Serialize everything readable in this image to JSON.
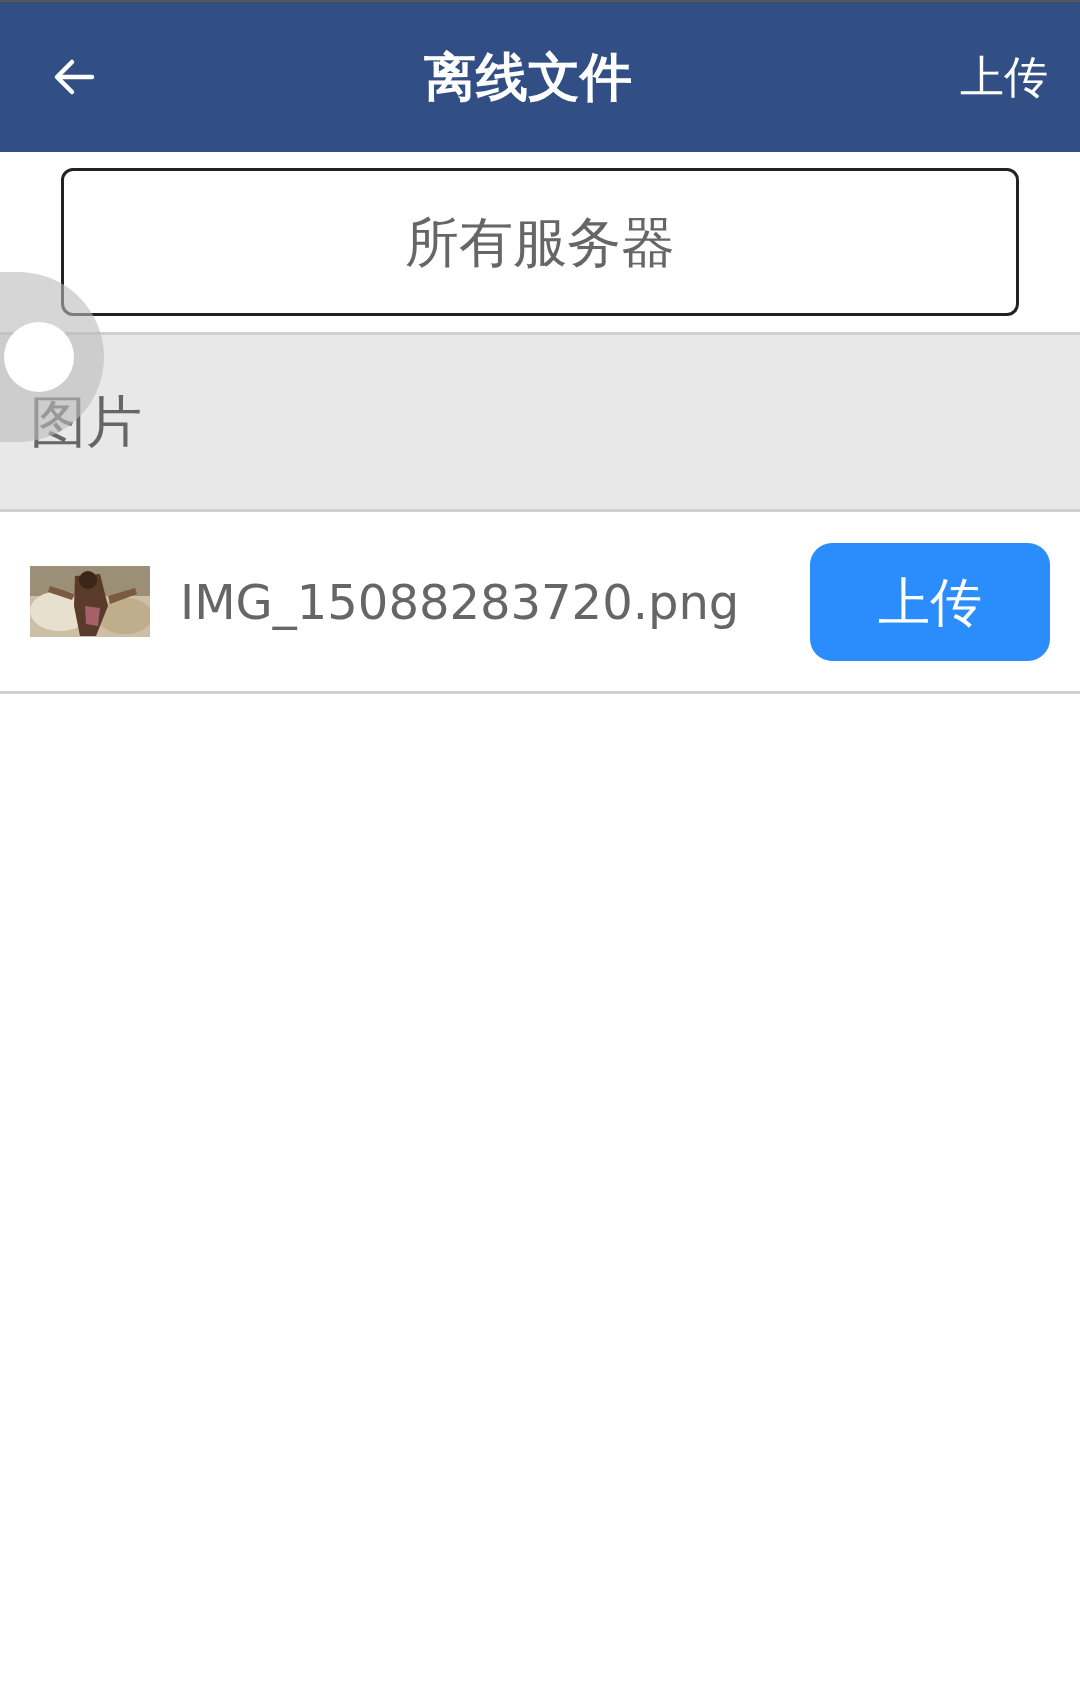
{
  "header": {
    "title": "离线文件",
    "action": "上传"
  },
  "server_selector": {
    "label": "所有服务器"
  },
  "sections": [
    {
      "title": "图片",
      "files": [
        {
          "name": "IMG_15088283720.png",
          "button": "上传"
        }
      ]
    }
  ]
}
